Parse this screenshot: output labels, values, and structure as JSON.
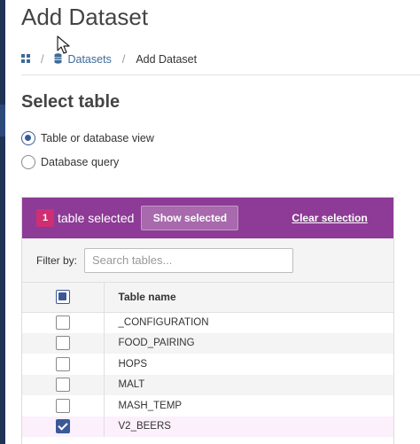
{
  "page": {
    "title": "Add Dataset"
  },
  "breadcrumb": {
    "home_icon": "grid-icon",
    "datasets_icon": "database-icon",
    "separator": "/",
    "items": [
      "Datasets",
      "Add Dataset"
    ]
  },
  "section": {
    "title": "Select table"
  },
  "source": {
    "options": [
      {
        "label": "Table or database view",
        "selected": true
      },
      {
        "label": "Database query",
        "selected": false
      }
    ]
  },
  "selection": {
    "count": "1",
    "label": "table selected",
    "show_selected": "Show selected",
    "clear_selection": "Clear selection"
  },
  "filter": {
    "label": "Filter by:",
    "placeholder": "Search tables..."
  },
  "table": {
    "header": "Table name",
    "rows": [
      {
        "name": "_CONFIGURATION",
        "checked": false
      },
      {
        "name": "FOOD_PAIRING",
        "checked": false
      },
      {
        "name": "HOPS",
        "checked": false
      },
      {
        "name": "MALT",
        "checked": false
      },
      {
        "name": "MASH_TEMP",
        "checked": false
      },
      {
        "name": "V2_BEERS",
        "checked": true
      }
    ]
  },
  "colors": {
    "header_bg": "#8d3b96",
    "badge": "#cf2f72",
    "accent": "#3b5998",
    "link": "#3d6a9a",
    "rail": "#1f3354"
  }
}
